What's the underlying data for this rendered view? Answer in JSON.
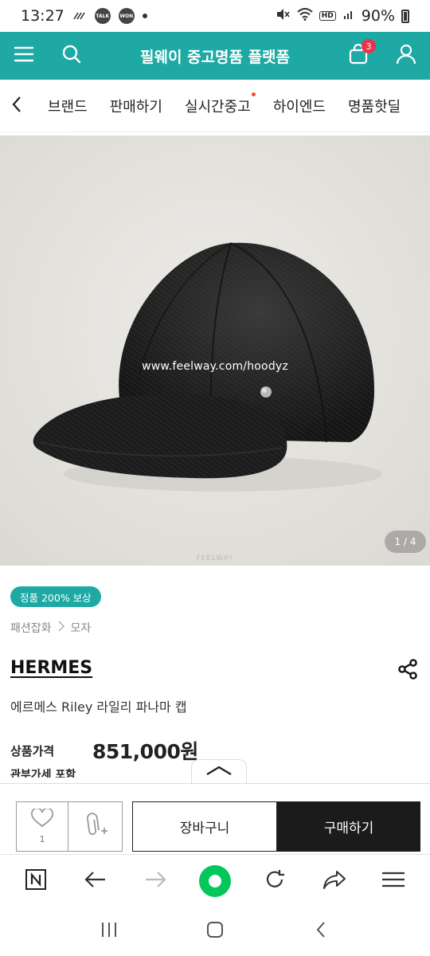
{
  "status_bar": {
    "time": "13:27",
    "notif_talk": "TALK",
    "notif_won": "WON",
    "hd_label": "HD",
    "battery": "90%"
  },
  "header": {
    "title": "필웨이 중고명품 플랫폼",
    "cart_count": "3"
  },
  "categories": [
    "브랜드",
    "판매하기",
    "실시간중고",
    "하이엔드",
    "명품핫딜"
  ],
  "product_image": {
    "watermark": "www.feelway.com/hoodyz",
    "brand_mark": "FEELWAY",
    "counter": "1 / 4"
  },
  "product": {
    "badge": "정품 200% 보상",
    "breadcrumb": [
      "패션잡화",
      "모자"
    ],
    "brand": "HERMES",
    "name": "에르메스 Riley 라일리 파나마 캡",
    "price_label": "상품가격",
    "price": "851,000원",
    "tax_note": "관부가세 포함"
  },
  "buy_bar": {
    "like_count": "1",
    "cart_label": "장바구니",
    "buy_label": "구매하기"
  },
  "colors": {
    "brand_teal": "#1ea9a4",
    "cart_badge": "#e8344a",
    "naver_green": "#03c75a",
    "buy_button": "#1b1b1b"
  }
}
